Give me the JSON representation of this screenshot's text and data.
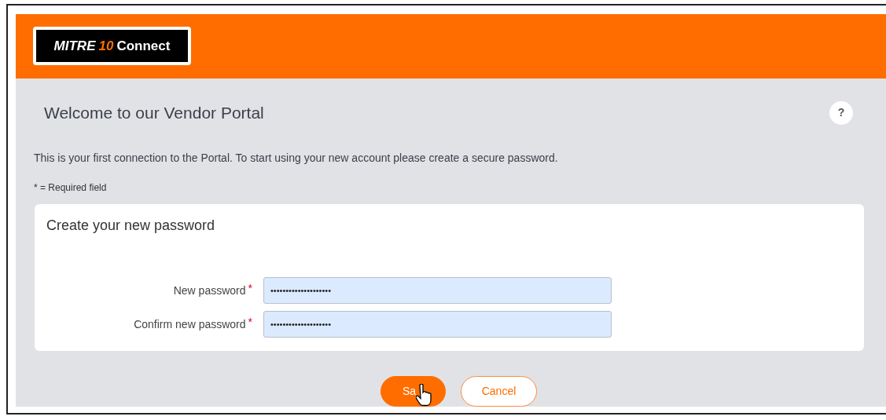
{
  "header": {
    "logo": {
      "word": "MITRE",
      "mark": "10",
      "product": "Connect"
    }
  },
  "page": {
    "title": "Welcome to our Vendor Portal",
    "help": "?",
    "intro": "This is your first connection to the Portal. To start using your new account please create a secure password.",
    "required_note": "* = Required field"
  },
  "card": {
    "title": "Create your new password",
    "fields": [
      {
        "label": "New password",
        "required_mark": "*",
        "value": "••••••••••••••••••••"
      },
      {
        "label": "Confirm new password",
        "required_mark": "*",
        "value": "••••••••••••••••••••"
      }
    ]
  },
  "buttons": [
    {
      "label": "Sa",
      "kind": "primary"
    },
    {
      "label": "Cancel",
      "kind": "secondary"
    }
  ]
}
